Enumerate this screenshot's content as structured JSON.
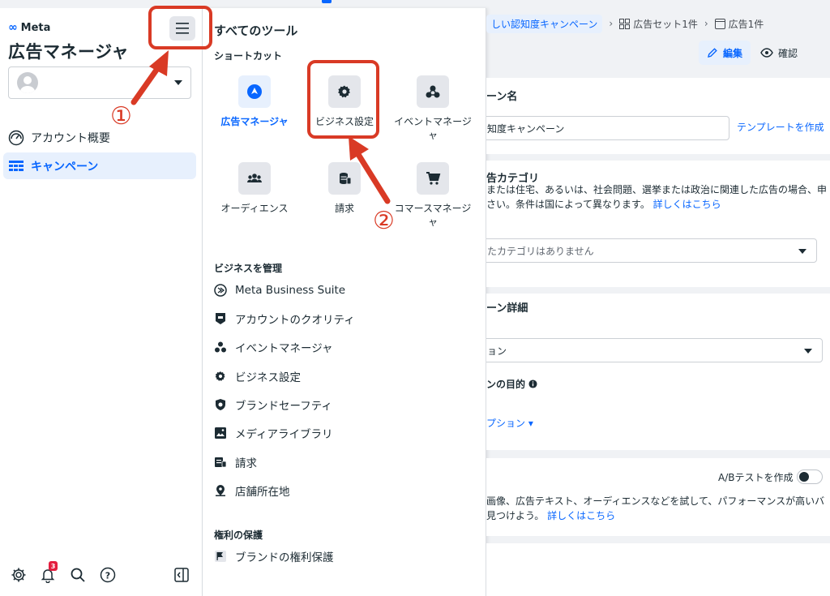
{
  "sidebar": {
    "brand": "Meta",
    "app_title": "広告マネージャ",
    "nav": [
      {
        "label": "アカウント概要"
      },
      {
        "label": "キャンペーン"
      }
    ],
    "bottom": {
      "notification_count": "3"
    }
  },
  "tools": {
    "title": "すべてのツール",
    "shortcuts_label": "ショートカット",
    "shortcuts": [
      {
        "label": "広告マネージャ",
        "icon": "navigation-arrow-icon"
      },
      {
        "label": "ビジネス設定",
        "icon": "gear-icon"
      },
      {
        "label": "イベントマネージャ",
        "icon": "events-icon"
      },
      {
        "label": "オーディエンス",
        "icon": "people-icon"
      },
      {
        "label": "請求",
        "icon": "billing-icon"
      },
      {
        "label": "コマースマネージャ",
        "icon": "cart-icon"
      }
    ],
    "manage_label": "ビジネスを管理",
    "manage_items": [
      {
        "label": "Meta Business Suite"
      },
      {
        "label": "アカウントのクオリティ"
      },
      {
        "label": "イベントマネージャ"
      },
      {
        "label": "ビジネス設定"
      },
      {
        "label": "ブランドセーフティ"
      },
      {
        "label": "メディアライブラリ"
      },
      {
        "label": "請求"
      },
      {
        "label": "店舗所在地"
      }
    ],
    "rights_label": "権利の保護",
    "rights_items": [
      {
        "label": "ブランドの権利保護"
      }
    ]
  },
  "main": {
    "breadcrumb": {
      "campaign": "しい認知度キャンペーン",
      "adset": "広告セット1件",
      "ad": "広告1件"
    },
    "edit_label": "編集",
    "confirm_label": "確認",
    "name_section": {
      "heading": "ーン名",
      "value": "知度キャンペーン",
      "template_link": "テンプレートを作成"
    },
    "category_section": {
      "heading": "告カテゴリ",
      "desc_line1": "または住宅、あるいは、社会問題、選挙または政治に関連した広告の場合、申",
      "desc_line2": "さい。条件は国によって異なります。",
      "learn_more": "詳しくはこちら",
      "select_value": "たカテゴリはありません"
    },
    "details_section": {
      "heading": "ーン詳細",
      "select_value": "ョン",
      "objective_label": "ンの目的",
      "option_link": "プション"
    },
    "ab_section": {
      "toggle_label": "A/Bテストを作成",
      "desc_line1": "画像、広告テキスト、オーディエンスなどを試して、パフォーマンスが高いバ",
      "desc_line2": "見つけよう。",
      "learn_more": "詳しくはこちら"
    }
  },
  "annotations": {
    "step1": "①",
    "step2": "②",
    "color": "#d93a25"
  },
  "colors": {
    "accent": "#0866ff",
    "annotation": "#d93a25"
  }
}
